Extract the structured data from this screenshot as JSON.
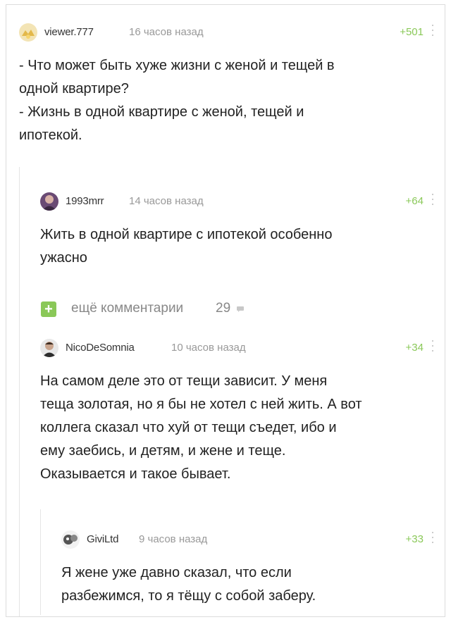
{
  "comments": [
    {
      "author": "viewer.777",
      "time": "16 часов назад",
      "rating": "+501",
      "lines": [
        "- Что может быть хуже жизни с женой и тещей в",
        "одной квартире?",
        "- Жизнь в одной квартире с женой, тещей и",
        "ипотекой."
      ]
    },
    {
      "author": "1993mrr",
      "time": "14 часов назад",
      "rating": "+64",
      "lines": [
        "Жить в одной квартире с ипотекой особенно",
        "ужасно"
      ]
    },
    {
      "author": "NicoDeSomnia",
      "time": "10 часов назад",
      "rating": "+34",
      "lines": [
        "На самом деле это от тещи зависит. У меня",
        "теща золотая, но я бы не хотел с ней жить. А вот",
        "коллега сказал что хуй от тещи съедет, ибо и",
        "ему заебись, и детям, и жене и теще.",
        "Оказывается и такое бывает."
      ]
    },
    {
      "author": "GiviLtd",
      "time": "9 часов назад",
      "rating": "+33",
      "lines": [
        "Я жене уже давно сказал, что если",
        "разбежимся, то я тёщу с собой заберу."
      ]
    }
  ],
  "more_comments": {
    "label": "ещё комментарии",
    "count": "29",
    "plus": "+"
  },
  "icons": [
    "more-dots-icon",
    "expand-plus-icon",
    "comment-bubble-icon"
  ],
  "colors": {
    "rating": "#8ac858",
    "meta": "#999999",
    "text": "#222222"
  }
}
